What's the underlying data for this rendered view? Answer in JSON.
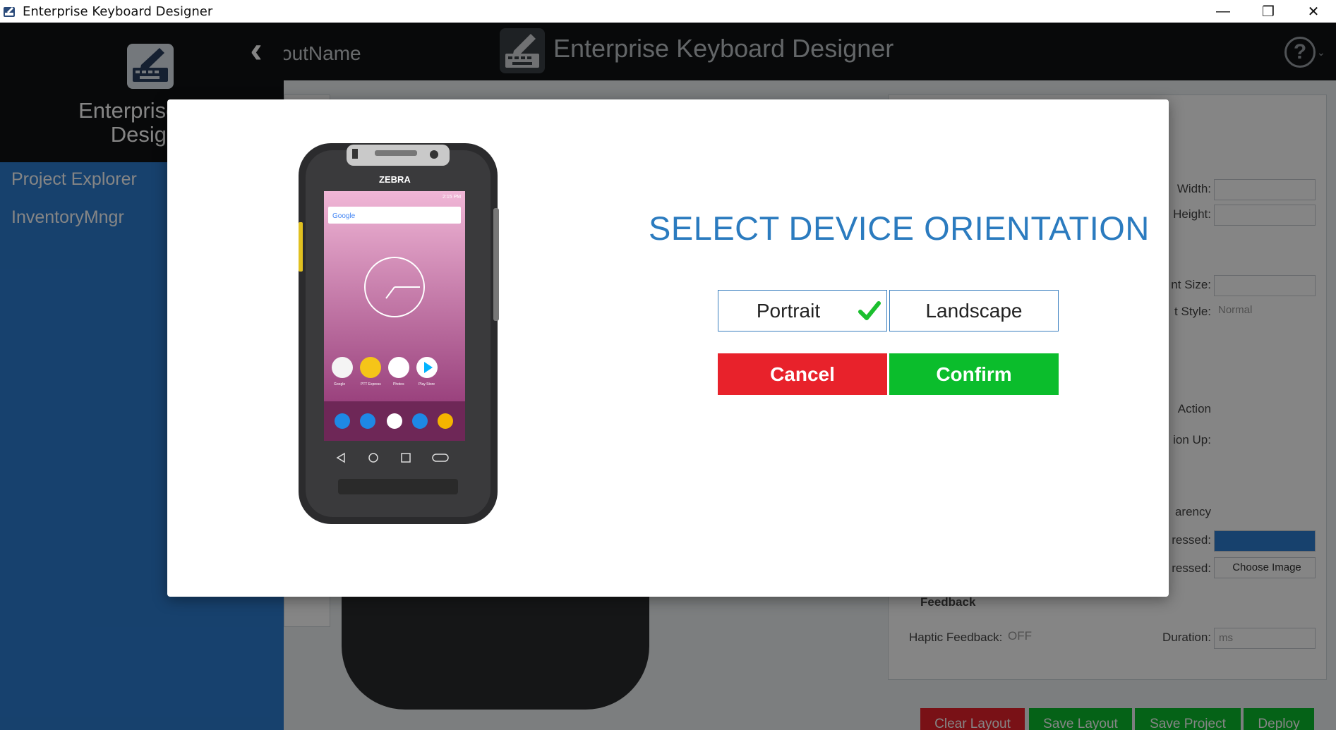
{
  "window": {
    "title": "Enterprise Keyboard Designer",
    "controls": [
      "—",
      "❐",
      "✕"
    ]
  },
  "header": {
    "layout_name": "outName",
    "title": "Enterprise Keyboard Designer",
    "help": "?",
    "help_caret": "⌄"
  },
  "sidebar": {
    "brand_line1": "Enterprise Ke",
    "brand_line2": "Design",
    "back": "‹",
    "items": [
      {
        "label": "Project Explorer"
      },
      {
        "label": "InventoryMngr"
      }
    ]
  },
  "background": {
    "width_label": "Width:",
    "height_label": "Height:",
    "font_size_label": "nt Size:",
    "font_style_label": "t Style:",
    "font_style_value": "Normal",
    "action_label": "Action",
    "action_up_label": "ion Up:",
    "transparency_label": "arency",
    "pressed_label": "ressed:",
    "unpressed_label": "ressed:",
    "choose_image": "Choose Image",
    "feedback_heading": "Feedback",
    "haptic_label": "Haptic Feedback:",
    "haptic_value": "OFF",
    "duration_label": "Duration:",
    "duration_value": "ms",
    "buttons": {
      "clear": "Clear Layout",
      "save_layout": "Save Layout",
      "save_project": "Save Project",
      "deploy": "Deploy"
    }
  },
  "modal": {
    "heading": "SELECT DEVICE ORIENTATION",
    "portrait": "Portrait",
    "landscape": "Landscape",
    "selected": "portrait",
    "cancel": "Cancel",
    "confirm": "Confirm",
    "colors": {
      "cancel": "#e8222b",
      "confirm": "#0bbd2c",
      "heading": "#2b7bbf"
    },
    "device": {
      "brand": "ZEBRA",
      "status_time": "2:15 PM",
      "search_brand": "Google",
      "apps": [
        "Google",
        "PTT Express",
        "Photos",
        "Play Store"
      ]
    }
  }
}
